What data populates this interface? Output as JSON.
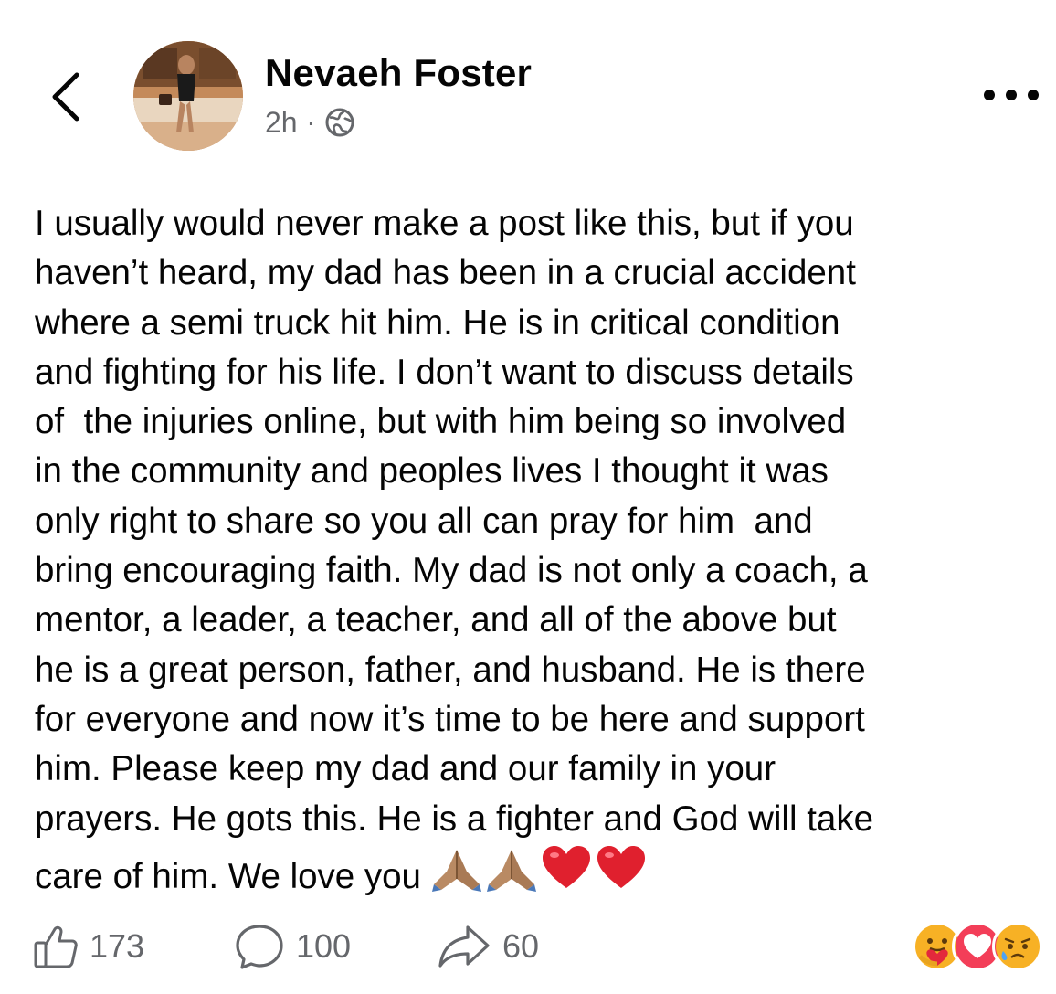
{
  "author": {
    "name": "Nevaeh Foster",
    "time": "2h",
    "separator": "·",
    "audience_icon": "globe-icon"
  },
  "nav": {
    "back_icon": "chevron-left-icon",
    "more_icon": "more-dots-icon"
  },
  "post": {
    "lines": [
      "I usually would never make a post like this, but if you",
      "haven’t heard, my dad has been in a crucial accident",
      "where a semi truck hit him. He is in critical condition",
      "and fighting for his life. I don’t want to discuss details",
      "of  the injuries online, but with him being so involved",
      "in the community and peoples lives I thought it was",
      "only right to share so you all can pray for him  and",
      "bring encouraging faith. My dad is not only a coach, a",
      "mentor, a leader, a teacher, and all of the above but",
      "he is a great person, father, and husband. He is there",
      "for everyone and now it’s time to be here and support",
      "him. Please keep my dad and our family in your",
      "prayers. He gots this. He is a fighter and God will take",
      "care of him. We love you"
    ],
    "trailing_emojis": [
      "folded-hands-emoji",
      "folded-hands-emoji",
      "red-heart-emoji",
      "red-heart-emoji"
    ]
  },
  "stats": {
    "likes": "173",
    "comments": "100",
    "shares": "60",
    "reactions": [
      "care-reaction",
      "love-reaction",
      "sad-reaction"
    ]
  },
  "colors": {
    "text": "#050505",
    "secondary": "#65676b",
    "love": "#f33e58",
    "emoji_yellow": "#f7b125"
  }
}
